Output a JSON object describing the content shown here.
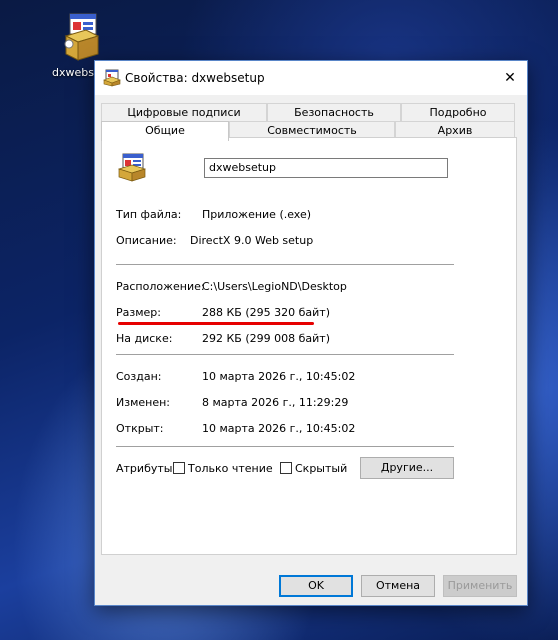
{
  "desktop": {
    "icon_label": "dxwebs"
  },
  "window": {
    "title": "Свойства: dxwebsetup",
    "close_glyph": "✕",
    "tabs_top": [
      "Цифровые подписи",
      "Безопасность",
      "Подробно"
    ],
    "tabs_bottom": [
      "Общие",
      "Совместимость",
      "Архив"
    ],
    "active_tab": "Общие"
  },
  "general": {
    "file_name": "dxwebsetup",
    "type_label": "Тип файла:",
    "type_value": "Приложение (.exe)",
    "desc_label": "Описание:",
    "desc_value": "DirectX 9.0 Web setup",
    "location_label": "Расположение:",
    "location_value": "C:\\Users\\LegioND\\Desktop",
    "size_label": "Размер:",
    "size_value": "288 КБ (295 320 байт)",
    "disk_label": "На диске:",
    "disk_value": "292 КБ (299 008 байт)",
    "created_label": "Создан:",
    "created_value": "10 марта 2026 г., 10:45:02",
    "modified_label": "Изменен:",
    "modified_value": "8 марта 2026 г., 11:29:29",
    "accessed_label": "Открыт:",
    "accessed_value": "10 марта 2026 г., 10:45:02",
    "attributes_label": "Атрибуты:",
    "readonly_label": "Только чтение",
    "hidden_label": "Скрытый",
    "other_button": "Другие...",
    "readonly_checked": false,
    "hidden_checked": false
  },
  "buttons": {
    "ok": "OK",
    "cancel": "Отмена",
    "apply": "Применить"
  },
  "colors": {
    "highlight_underline": "#e60000",
    "default_button_border": "#0078d7"
  }
}
